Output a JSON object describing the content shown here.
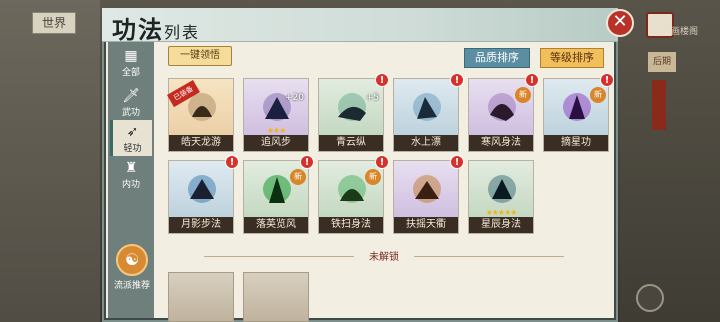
{
  "background": {
    "world_button": "世界",
    "scroll_label": "画楼阁",
    "back_label": "后期"
  },
  "panel": {
    "title_main": "功法",
    "title_small": "列表",
    "close_icon": "close-icon"
  },
  "sidebar": {
    "tabs": [
      {
        "label": "全部",
        "icon": "▦"
      },
      {
        "label": "武功",
        "icon": "🗡"
      },
      {
        "label": "轻功",
        "icon": "➶"
      },
      {
        "label": "内功",
        "icon": "♜"
      }
    ],
    "active_index": 2,
    "recommend_label": "流派推荐"
  },
  "toolbar": {
    "claim_label": "一键领悟",
    "sort_quality_label": "品质排序",
    "sort_level_label": "等级排序"
  },
  "cards": [
    {
      "name": "皓天龙游",
      "bg": "gold",
      "equipped_tag": "已装备",
      "alert": false,
      "new": false,
      "level": "",
      "stars": 0
    },
    {
      "name": "追风步",
      "bg": "purple",
      "level": "+20",
      "stars": 3,
      "alert": false,
      "new": false
    },
    {
      "name": "青云纵",
      "bg": "green",
      "level": "+5",
      "stars": 0,
      "alert": true,
      "new": false
    },
    {
      "name": "水上漂",
      "bg": "blue",
      "level": "",
      "stars": 0,
      "alert": true,
      "new": false
    },
    {
      "name": "寒风身法",
      "bg": "purple",
      "level": "",
      "stars": 0,
      "alert": true,
      "new": true
    },
    {
      "name": "摘星功",
      "bg": "blue",
      "level": "",
      "stars": 0,
      "alert": true,
      "new": true
    },
    {
      "name": "月影步法",
      "bg": "blue",
      "level": "",
      "stars": 0,
      "alert": true,
      "new": false
    },
    {
      "name": "落英览风",
      "bg": "green",
      "level": "",
      "stars": 0,
      "alert": true,
      "new": true
    },
    {
      "name": "铁扫身法",
      "bg": "green",
      "level": "",
      "stars": 0,
      "alert": true,
      "new": true
    },
    {
      "name": "扶摇天衢",
      "bg": "purple",
      "level": "",
      "stars": 0,
      "alert": true,
      "new": false
    },
    {
      "name": "星辰身法",
      "bg": "green",
      "level": "",
      "stars": 5,
      "alert": false,
      "new": false
    }
  ],
  "locked_section": {
    "label": "未解锁"
  },
  "colors": {
    "panel_bg": "#f3eee2",
    "sidebar": "#6f7f7b",
    "alert": "#d8302a",
    "sort_quality": "#5a8ea0",
    "sort_level": "#f2c05a"
  }
}
